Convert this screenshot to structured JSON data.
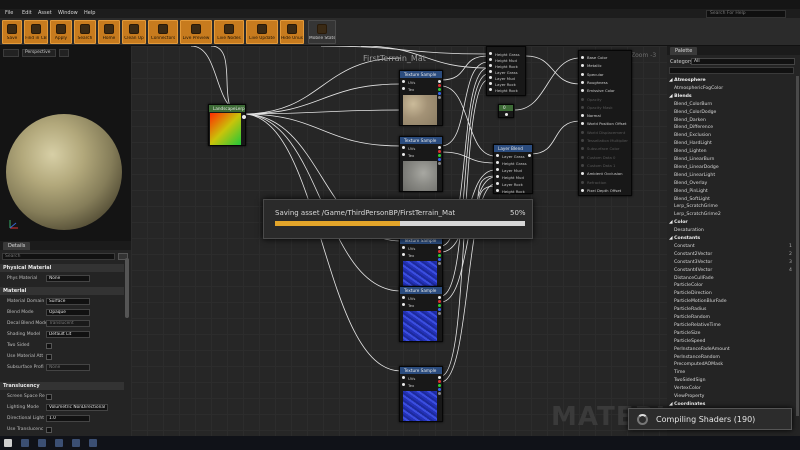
{
  "window": {
    "title": "FirstTerrain_Mat",
    "search_placeholder": "Search For Help"
  },
  "menu": [
    "File",
    "Edit",
    "Asset",
    "Window",
    "Help"
  ],
  "toolbar": [
    {
      "label": "Save",
      "icon": "save-icon"
    },
    {
      "label": "Find in CB",
      "icon": "find-in-cb-icon"
    },
    {
      "label": "Apply",
      "icon": "apply-icon"
    },
    {
      "label": "Search",
      "icon": "search-icon"
    },
    {
      "label": "Home",
      "icon": "home-icon"
    },
    {
      "label": "Clean Up",
      "icon": "clean-up-icon"
    },
    {
      "label": "Connectors",
      "icon": "connectors-icon"
    },
    {
      "label": "Live Preview",
      "icon": "live-preview-icon"
    },
    {
      "label": "Live Nodes",
      "icon": "live-nodes-icon"
    },
    {
      "label": "Live Update",
      "icon": "live-update-icon"
    },
    {
      "label": "Hide Unused",
      "icon": "hide-unused-icon"
    },
    {
      "label": "Mobile Stats",
      "icon": "mobile-stats-icon"
    }
  ],
  "viewport": {
    "label": "Perspective"
  },
  "details": {
    "tab": "Details",
    "search_placeholder": "Search",
    "categories": [
      "Physical Material",
      "Material",
      "Translucency"
    ],
    "physical": [
      {
        "label": "Phys Material",
        "value": "None"
      }
    ],
    "material": [
      {
        "label": "Material Domain",
        "value": "Surface"
      },
      {
        "label": "Blend Mode",
        "value": "Opaque"
      },
      {
        "label": "Decal Blend Mode",
        "value": "Translucent",
        "dim": true
      },
      {
        "label": "Shading Model",
        "value": "Default Lit"
      },
      {
        "label": "Two Sided",
        "checkbox": true
      },
      {
        "label": "Use Material Att",
        "checkbox": true
      },
      {
        "label": "Subsurface Profi",
        "value": "None",
        "dim": true
      }
    ],
    "translucency": [
      {
        "label": "Screen Space Re",
        "checkbox": true
      },
      {
        "label": "Lighting Mode",
        "value": "Volumetric NonDirectional"
      },
      {
        "label": "Directional Light",
        "value": "1.0"
      },
      {
        "label": "Use Translucenc",
        "checkbox": true
      }
    ]
  },
  "graph": {
    "title": "FirstTerrain_Mat",
    "zoom": "Zoom -3",
    "watermark": "MATERI",
    "landscape_node": {
      "title": "LandscapeLerpB"
    },
    "texture_nodes": [
      {
        "title": "Texture Sample",
        "pins": [
          "UVs",
          "Tex"
        ],
        "tex": "sand"
      },
      {
        "title": "Texture Sample",
        "pins": [
          "UVs",
          "Tex"
        ],
        "tex": "rock"
      },
      {
        "title": "Texture Sample",
        "pins": [
          "UVs",
          "Tex"
        ],
        "tex": "blue"
      },
      {
        "title": "Texture Sample",
        "pins": [
          "UVs",
          "Tex"
        ],
        "tex": "blue"
      },
      {
        "title": "Texture Sample",
        "pins": [
          "UVs",
          "Tex"
        ],
        "tex": "blue"
      }
    ],
    "blend_top_pins": [
      "Height Grass",
      "Height Mud",
      "Height Rock",
      "Layer Grass",
      "Layer Mud",
      "Layer Rock",
      "Height Rock"
    ],
    "blend_node": {
      "title": "Layer Blend",
      "pins": [
        "Layer Grass",
        "Height Grass",
        "Layer Mud",
        "Height Mud",
        "Layer Rock",
        "Height Rock"
      ]
    },
    "const_node": {
      "title": "0"
    },
    "result_pins": [
      {
        "label": "Base Color",
        "dim": false
      },
      {
        "label": "Metallic",
        "dim": false
      },
      {
        "label": "Specular",
        "dim": false
      },
      {
        "label": "Roughness",
        "dim": false
      },
      {
        "label": "Emissive Color",
        "dim": false
      },
      {
        "label": "Opacity",
        "dim": true
      },
      {
        "label": "Opacity Mask",
        "dim": true
      },
      {
        "label": "Normal",
        "dim": false
      },
      {
        "label": "World Position Offset",
        "dim": false
      },
      {
        "label": "World Displacement",
        "dim": true
      },
      {
        "label": "Tessellation Multiplier",
        "dim": true
      },
      {
        "label": "Subsurface Color",
        "dim": true
      },
      {
        "label": "Custom Data 0",
        "dim": true
      },
      {
        "label": "Custom Data 1",
        "dim": true
      },
      {
        "label": "Ambient Occlusion",
        "dim": false
      },
      {
        "label": "Refraction",
        "dim": true
      },
      {
        "label": "Pixel Depth Offset",
        "dim": false
      }
    ]
  },
  "progress": {
    "text": "Saving asset /Game/ThirdPersonBP/FirstTerrain_Mat",
    "percent_label": "50%",
    "fraction": 0.5
  },
  "palette": {
    "tab": "Palette",
    "category_label": "Category",
    "category_value": "All",
    "items": [
      {
        "label": "Atmosphere",
        "cat": true
      },
      {
        "label": "AtmosphericFogColor"
      },
      {
        "label": "Blends",
        "cat": true
      },
      {
        "label": "Blend_ColorBurn"
      },
      {
        "label": "Blend_ColorDodge"
      },
      {
        "label": "Blend_Darken"
      },
      {
        "label": "Blend_Difference"
      },
      {
        "label": "Blend_Exclusion"
      },
      {
        "label": "Blend_HardLight"
      },
      {
        "label": "Blend_Lighten"
      },
      {
        "label": "Blend_LinearBurn"
      },
      {
        "label": "Blend_LinearDodge"
      },
      {
        "label": "Blend_LinearLight"
      },
      {
        "label": "Blend_Overlay"
      },
      {
        "label": "Blend_PinLight"
      },
      {
        "label": "Blend_SoftLight"
      },
      {
        "label": "Lerp_ScratchGrime"
      },
      {
        "label": "Lerp_ScratchGrime2"
      },
      {
        "label": "Color",
        "cat": true
      },
      {
        "label": "Desaturation"
      },
      {
        "label": "Constants",
        "cat": true
      },
      {
        "label": "Constant",
        "count": "1"
      },
      {
        "label": "Constant2Vector",
        "count": "2"
      },
      {
        "label": "Constant3Vector",
        "count": "3"
      },
      {
        "label": "Constant4Vector",
        "count": "4"
      },
      {
        "label": "DistanceCullFade"
      },
      {
        "label": "ParticleColor"
      },
      {
        "label": "ParticleDirection"
      },
      {
        "label": "ParticleMotionBlurFade"
      },
      {
        "label": "ParticleRadius"
      },
      {
        "label": "ParticleRandom"
      },
      {
        "label": "ParticleRelativeTime"
      },
      {
        "label": "ParticleSize"
      },
      {
        "label": "ParticleSpeed"
      },
      {
        "label": "PerInstanceFadeAmount"
      },
      {
        "label": "PerInstanceRandom"
      },
      {
        "label": "PrecomputedAOMask"
      },
      {
        "label": "Time"
      },
      {
        "label": "TwoSidedSign"
      },
      {
        "label": "VertexColor"
      },
      {
        "label": "ViewProperty"
      },
      {
        "label": "Coordinates",
        "cat": true
      }
    ]
  },
  "toast": {
    "text": "Compiling Shaders (190)"
  },
  "taskbar": {
    "icons": [
      "start-icon",
      "search-icon",
      "task-view-icon",
      "explorer-icon",
      "unreal-icon",
      "app-icon"
    ]
  }
}
